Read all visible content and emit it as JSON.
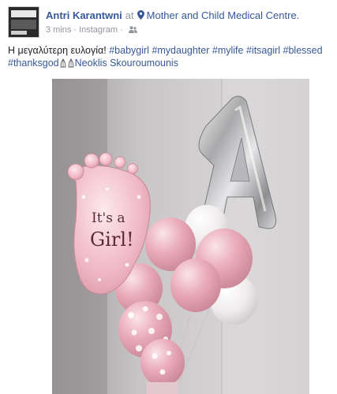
{
  "post": {
    "author": "Antri Karantwni",
    "at": "at",
    "place_icon": "map-pin-icon",
    "place": "Mother and Child Medical Centre.",
    "time": "3 mins",
    "separator": "·",
    "source": "Instagram",
    "privacy_icon": "friends-icon",
    "text": {
      "greek": "Η μεγαλύτερη ευλογία! ",
      "hashtags": [
        "#babygirl",
        "#mydaughter",
        "#mylife",
        "#itsagirl",
        "#blessed",
        "#thanksgod"
      ],
      "emoji": "praying-hands-icon",
      "tagged": "Neoklis Skouroumounis"
    }
  },
  "photo": {
    "balloon_text_1": "It's a",
    "balloon_text_2": "Girl!",
    "foil_letter": "A"
  }
}
